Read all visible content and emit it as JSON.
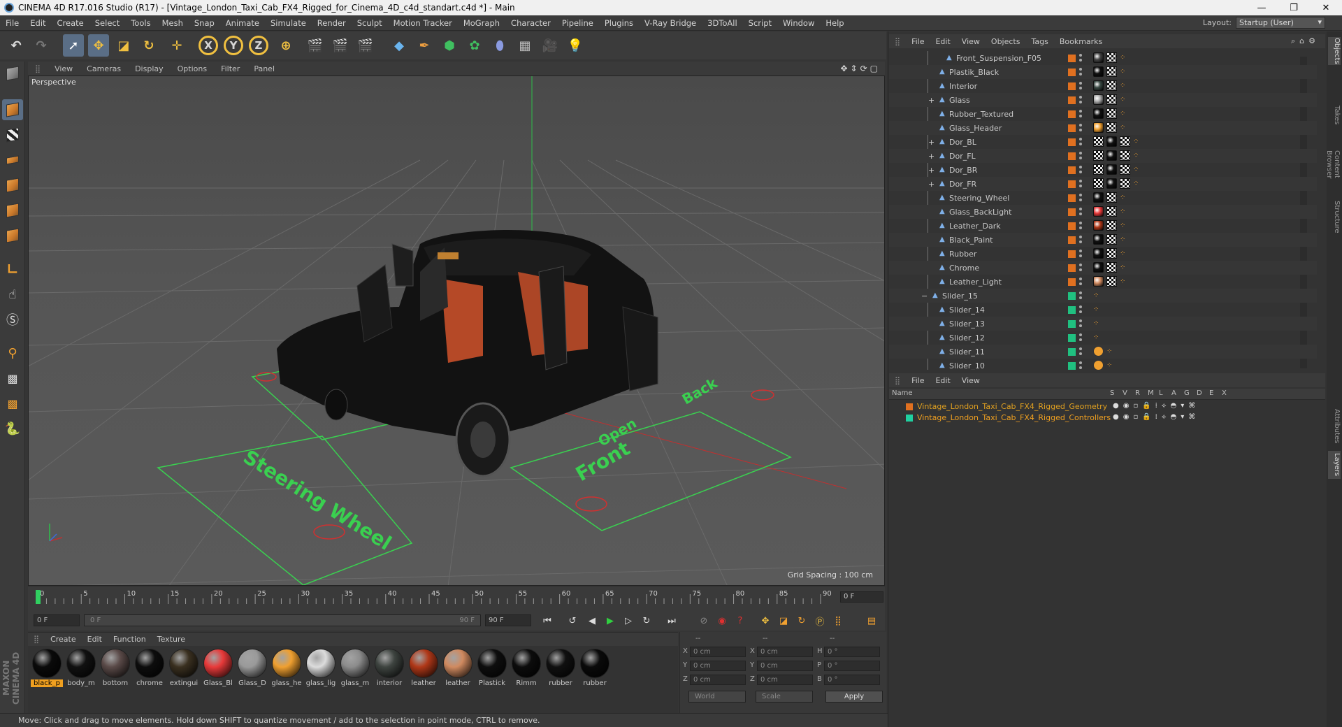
{
  "window": {
    "title": "CINEMA 4D R17.016 Studio (R17) - [Vintage_London_Taxi_Cab_FX4_Rigged_for_Cinema_4D_c4d_standart.c4d *] - Main",
    "minimize": "—",
    "maximize": "❐",
    "close": "✕"
  },
  "menu": {
    "items": [
      "File",
      "Edit",
      "Create",
      "Select",
      "Tools",
      "Mesh",
      "Snap",
      "Animate",
      "Simulate",
      "Render",
      "Sculpt",
      "Motion Tracker",
      "MoGraph",
      "Character",
      "Pipeline",
      "Plugins",
      "V-Ray Bridge",
      "3DToAll",
      "Script",
      "Window",
      "Help"
    ],
    "layout_label": "Layout:",
    "layout_value": "Startup (User)"
  },
  "toolbar": {
    "axis_x": "X",
    "axis_y": "Y",
    "axis_z": "Z"
  },
  "viewport": {
    "menu": [
      "View",
      "Cameras",
      "Display",
      "Options",
      "Filter",
      "Panel"
    ],
    "label": "Perspective",
    "grid_spacing": "Grid Spacing : 100 cm",
    "floor_text_1": "Steering Wheel",
    "floor_text_2": "Front",
    "floor_text_3": "Open",
    "floor_text_4": "Back"
  },
  "timeline": {
    "ticks": [
      "0",
      "5",
      "10",
      "15",
      "20",
      "25",
      "30",
      "35",
      "40",
      "45",
      "50",
      "55",
      "60",
      "65",
      "70",
      "75",
      "80",
      "85",
      "90"
    ],
    "current_frame": "0 F",
    "start_field": "0 F",
    "range_start": "0 F",
    "range_end": "90 F",
    "end_field": "90 F"
  },
  "materials": {
    "menu": [
      "Create",
      "Edit",
      "Function",
      "Texture"
    ],
    "items": [
      {
        "label": "black_p",
        "color": "#0a0a0a"
      },
      {
        "label": "body_m",
        "color": "#111111"
      },
      {
        "label": "bottom",
        "color": "#5a4a48"
      },
      {
        "label": "chrome",
        "color": "#0d0d0d"
      },
      {
        "label": "extingui",
        "color": "#3a3020"
      },
      {
        "label": "Glass_Bl",
        "color": "#e83a3a"
      },
      {
        "label": "Glass_D",
        "color": "#9a9a9a"
      },
      {
        "label": "glass_he",
        "color": "#f0a030"
      },
      {
        "label": "glass_lig",
        "color": "#dcdcdc"
      },
      {
        "label": "glass_m",
        "color": "#8c8c8c"
      },
      {
        "label": "interior",
        "color": "#3e4440"
      },
      {
        "label": "leather",
        "color": "#b03818"
      },
      {
        "label": "leather",
        "color": "#d08a60"
      },
      {
        "label": "Plastick",
        "color": "#0e0e0e"
      },
      {
        "label": "Rimm",
        "color": "#0c0c0c"
      },
      {
        "label": "rubber",
        "color": "#101010"
      },
      {
        "label": "rubber",
        "color": "#0a0a0a"
      }
    ]
  },
  "coordinates": {
    "header": [
      "--",
      "--",
      "--"
    ],
    "rows": [
      {
        "a": "X",
        "av": "0 cm",
        "b": "X",
        "bv": "0 cm",
        "c": "H",
        "cv": "0 °"
      },
      {
        "a": "Y",
        "av": "0 cm",
        "b": "Y",
        "bv": "0 cm",
        "c": "P",
        "cv": "0 °"
      },
      {
        "a": "Z",
        "av": "0 cm",
        "b": "Z",
        "bv": "0 cm",
        "c": "B",
        "cv": "0 °"
      }
    ],
    "mode1": "World",
    "mode2": "Scale",
    "apply": "Apply"
  },
  "status": "Move: Click and drag to move elements. Hold down SHIFT to quantize movement / add to the selection in point mode, CTRL to remove.",
  "maxon": "MAXON CINEMA 4D",
  "objects": {
    "menu": [
      "File",
      "Edit",
      "View",
      "Objects",
      "Tags",
      "Bookmarks"
    ],
    "rows": [
      {
        "name": "Front_Suspension_F05",
        "level": 2,
        "color": "#e07020",
        "tags": [
          "#444",
          "chk"
        ]
      },
      {
        "name": "Plastik_Black",
        "level": 1,
        "color": "#e07020",
        "tags": [
          "#111",
          "chk"
        ]
      },
      {
        "name": "Interior",
        "level": 1,
        "color": "#e07020",
        "tags": [
          "#3a4a44",
          "chk"
        ]
      },
      {
        "name": "Glass",
        "level": 1,
        "expand": "+",
        "color": "#e07020",
        "tags": [
          "#aaa",
          "chk"
        ]
      },
      {
        "name": "Rubber_Textured",
        "level": 1,
        "color": "#e07020",
        "tags": [
          "#111",
          "chk"
        ]
      },
      {
        "name": "Glass_Header",
        "level": 1,
        "color": "#e07020",
        "tags": [
          "#f0a030",
          "chk"
        ]
      },
      {
        "name": "Dor_BL",
        "level": 1,
        "expand": "+",
        "color": "#e07020",
        "tags": [
          "chk",
          "#111",
          "chk"
        ]
      },
      {
        "name": "Dor_FL",
        "level": 1,
        "expand": "+",
        "color": "#e07020",
        "tags": [
          "chk",
          "#111",
          "chk"
        ]
      },
      {
        "name": "Dor_BR",
        "level": 1,
        "expand": "+",
        "color": "#e07020",
        "tags": [
          "chk",
          "#111",
          "chk"
        ]
      },
      {
        "name": "Dor_FR",
        "level": 1,
        "expand": "+",
        "color": "#e07020",
        "tags": [
          "chk",
          "#111",
          "chk"
        ]
      },
      {
        "name": "Steering_Wheel",
        "level": 1,
        "color": "#e07020",
        "tags": [
          "#111",
          "chk"
        ]
      },
      {
        "name": "Glass_BackLight",
        "level": 1,
        "color": "#e07020",
        "tags": [
          "#e83a3a",
          "chk"
        ]
      },
      {
        "name": "Leather_Dark",
        "level": 1,
        "color": "#e07020",
        "tags": [
          "#b03818",
          "chk"
        ]
      },
      {
        "name": "Black_Paint",
        "level": 1,
        "color": "#e07020",
        "tags": [
          "#111",
          "chk"
        ]
      },
      {
        "name": "Rubber",
        "level": 1,
        "color": "#e07020",
        "tags": [
          "#111",
          "chk"
        ]
      },
      {
        "name": "Chrome",
        "level": 1,
        "color": "#e07020",
        "tags": [
          "#111",
          "chk"
        ]
      },
      {
        "name": "Leather_Light",
        "level": 1,
        "color": "#e07020",
        "tags": [
          "#d08a60",
          "chk"
        ]
      },
      {
        "name": "Slider_15",
        "level": 0,
        "expand": "−",
        "color": "#20c080",
        "tags": []
      },
      {
        "name": "Slider_14",
        "level": 1,
        "color": "#20c080",
        "tags": []
      },
      {
        "name": "Slider_13",
        "level": 1,
        "color": "#20c080",
        "tags": []
      },
      {
        "name": "Slider_12",
        "level": 1,
        "color": "#20c080",
        "tags": []
      },
      {
        "name": "Slider_11",
        "level": 1,
        "color": "#20c080",
        "tags": [
          "no"
        ]
      },
      {
        "name": "Slider_10",
        "level": 1,
        "color": "#20c080",
        "tags": [
          "no"
        ]
      }
    ]
  },
  "layers": {
    "menu": [
      "File",
      "Edit",
      "View"
    ],
    "columns": [
      "Name",
      "S",
      "V",
      "R",
      "M",
      "L",
      "A",
      "G",
      "D",
      "E",
      "X"
    ],
    "rows": [
      {
        "name": "Vintage_London_Taxi_Cab_FX4_Rigged_Geometry",
        "color": "#e07020",
        "text_color": "#e0a020"
      },
      {
        "name": "Vintage_London_Taxi_Cab_FX4_Rigged_Controllers",
        "color": "#20d0a0",
        "text_color": "#f0a020"
      }
    ]
  },
  "side_tabs": [
    "Objects",
    "Takes",
    "Content Browser",
    "Structure",
    "Attributes",
    "Layers"
  ]
}
